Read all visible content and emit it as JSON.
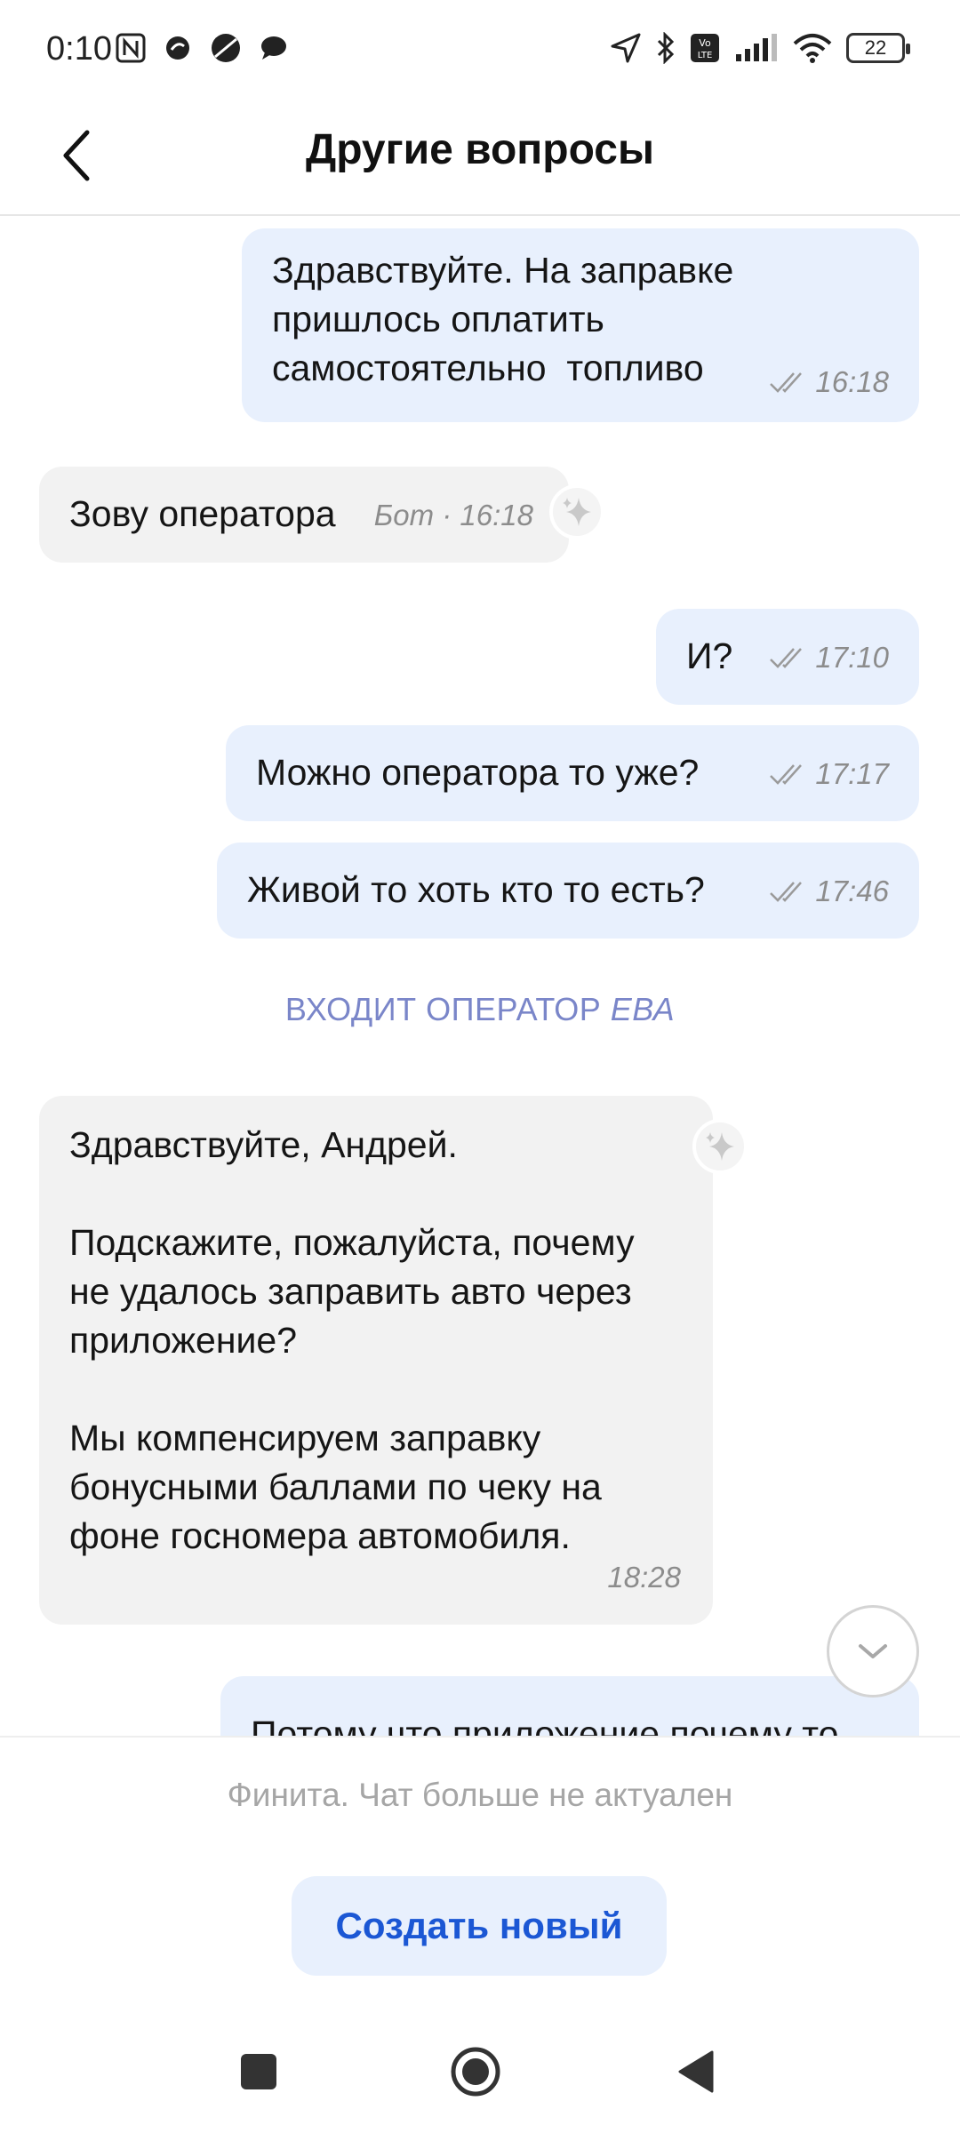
{
  "status_bar": {
    "time": "0:10",
    "battery": "22",
    "left_icons": [
      "nfc-icon",
      "app-notification-icon",
      "browser-icon",
      "chat-bubble-icon"
    ],
    "right_icons": [
      "location-icon",
      "bluetooth-icon",
      "volte-icon",
      "signal-icon",
      "wifi-icon"
    ]
  },
  "header": {
    "title": "Другие вопросы",
    "back_icon": "chevron-left-icon"
  },
  "messages": [
    {
      "from": "user",
      "text": "Здравствуйте. На заправке\nпришлось оплатить\nсамостоятельно  топливо",
      "time": "16:18",
      "status_icon": "double-check-icon"
    },
    {
      "from": "bot",
      "text": "Зову оператора",
      "meta": "Бот · 16:18",
      "badge_icon": "sparkle-icon"
    },
    {
      "from": "user",
      "text": "И?",
      "time": "17:10",
      "status_icon": "double-check-icon"
    },
    {
      "from": "user",
      "text": "Можно оператора то уже?",
      "time": "17:17",
      "status_icon": "double-check-icon"
    },
    {
      "from": "user",
      "text": "Живой то хоть кто то есть?",
      "time": "17:46",
      "status_icon": "double-check-icon"
    },
    {
      "from": "operator",
      "text": "Здравствуйте, Андрей.\n\nПодскажите, пожалуйста, почему\nне удалось заправить авто через\nприложение?\n\nМы компенсируем заправку\nбонусными баллами по чеку на\nфоне госномера автомобиля.",
      "time": "18:28",
      "badge_icon": "sparkle-icon"
    },
    {
      "from": "user",
      "text": "Потому что приложение почему то"
    }
  ],
  "operator_join": {
    "prefix": "ВХОДИТ ОПЕРАТОР",
    "name": "ЕВА"
  },
  "scroll_button_icon": "chevron-down-icon",
  "footer": {
    "status_text": "Финита. Чат больше не актуален",
    "create_button": "Создать новый"
  },
  "nav_bar": {
    "recents_icon": "square-icon",
    "home_icon": "home-circle-icon",
    "back_icon": "triangle-back-icon"
  },
  "colors": {
    "outgoing_bubble": "#e8f0fd",
    "incoming_bubble": "#f2f2f2",
    "operator_join_text": "#7a86c9",
    "button_text": "#1b57d4"
  }
}
